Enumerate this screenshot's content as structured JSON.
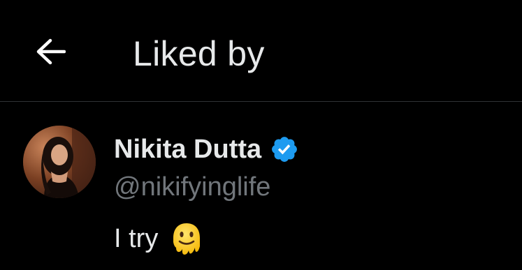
{
  "header": {
    "back_icon": "arrow-left-icon",
    "title": "Liked by"
  },
  "users": [
    {
      "display_name": "Nikita Dutta",
      "handle": "@nikifyinglife",
      "verified": true,
      "verified_icon": "verified-badge-icon",
      "bio": "I try",
      "bio_emoji": "melting-face-emoji"
    }
  ],
  "colors": {
    "background": "#000000",
    "primary_text": "#e7e9ea",
    "secondary_text": "#71767b",
    "divider": "#2f3336",
    "verified_blue": "#1d9bf0"
  }
}
